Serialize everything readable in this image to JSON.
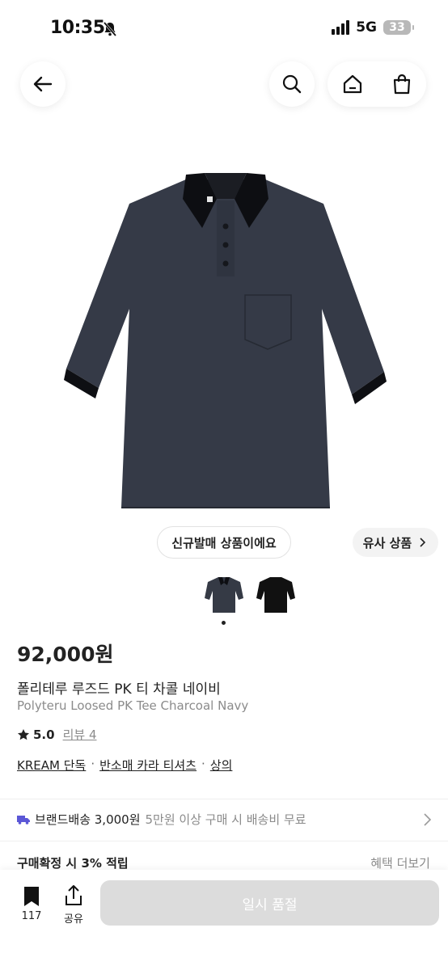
{
  "status_bar": {
    "time": "10:35",
    "network": "5G",
    "battery": "33"
  },
  "product": {
    "price": "92,000원",
    "name_ko": "폴리테루 루즈드 PK 티 차콜 네이비",
    "name_en": "Polyteru Loosed PK Tee Charcoal Navy",
    "rating": "5.0",
    "review_label": "리뷰 4",
    "new_release_badge": "신규발매 상품이에요",
    "similar_button": "유사 상품",
    "categories": [
      "KREAM 단독",
      "반소매 카라 티셔츠",
      "상의"
    ],
    "thumb_colors": [
      "#353a45",
      "#111111"
    ]
  },
  "delivery": {
    "label": "브랜드배송 3,000원",
    "note": "5만원 이상 구매 시 배송비 무료"
  },
  "points": {
    "label": "구매확정 시 3% 적립",
    "more": "혜택 더보기"
  },
  "bottom_bar": {
    "bookmark_count": "117",
    "share_label": "공유",
    "buy_label": "일시 품절"
  },
  "icons": [
    "back-arrow-icon",
    "search-icon",
    "home-icon",
    "bag-icon",
    "bell-slash-icon",
    "star-icon",
    "truck-icon",
    "chevron-right-icon",
    "bookmark-icon",
    "share-icon"
  ],
  "colors": {
    "accent_truck": "#5b57d6",
    "disabled_button": "#dcdcdc"
  }
}
